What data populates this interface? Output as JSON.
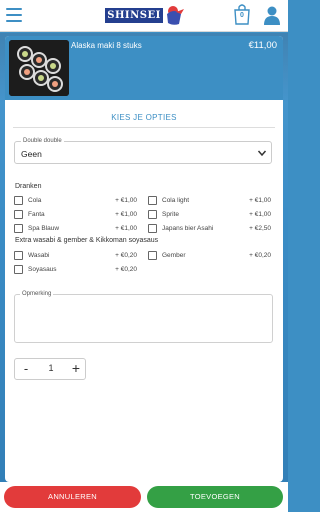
{
  "header": {
    "logo_text": "SHINSEI",
    "cart_count": "0",
    "accent_color": "#3d8fc4"
  },
  "product": {
    "name": "Alaska maki 8 stuks",
    "price": "€11,00"
  },
  "options": {
    "title": "KIES JE OPTIES",
    "select_label": "Double double",
    "select_value": "Geen",
    "groups": [
      {
        "title": "Dranken",
        "items": [
          {
            "name": "Cola",
            "price": "+ €1,00"
          },
          {
            "name": "Cola light",
            "price": "+ €1,00"
          },
          {
            "name": "Fanta",
            "price": "+ €1,00"
          },
          {
            "name": "Sprite",
            "price": "+ €1,00"
          },
          {
            "name": "Spa Blauw",
            "price": "+ €1,00"
          },
          {
            "name": "Japans bier Asahi",
            "price": "+ €2,50"
          }
        ]
      },
      {
        "title": "Extra wasabi & gember & Kikkoman soyasaus",
        "items": [
          {
            "name": "Wasabi",
            "price": "+ €0,20"
          },
          {
            "name": "Gember",
            "price": "+ €0,20"
          },
          {
            "name": "Soyasaus",
            "price": "+ €0,20"
          }
        ]
      }
    ]
  },
  "remark": {
    "label": "Opmerking"
  },
  "quantity": {
    "minus": "-",
    "value": "1",
    "plus": "+"
  },
  "footer": {
    "cancel_label": "ANNULEREN",
    "add_label": "TOEVOEGEN",
    "cancel_color": "#e23b3b",
    "add_color": "#34a045"
  }
}
